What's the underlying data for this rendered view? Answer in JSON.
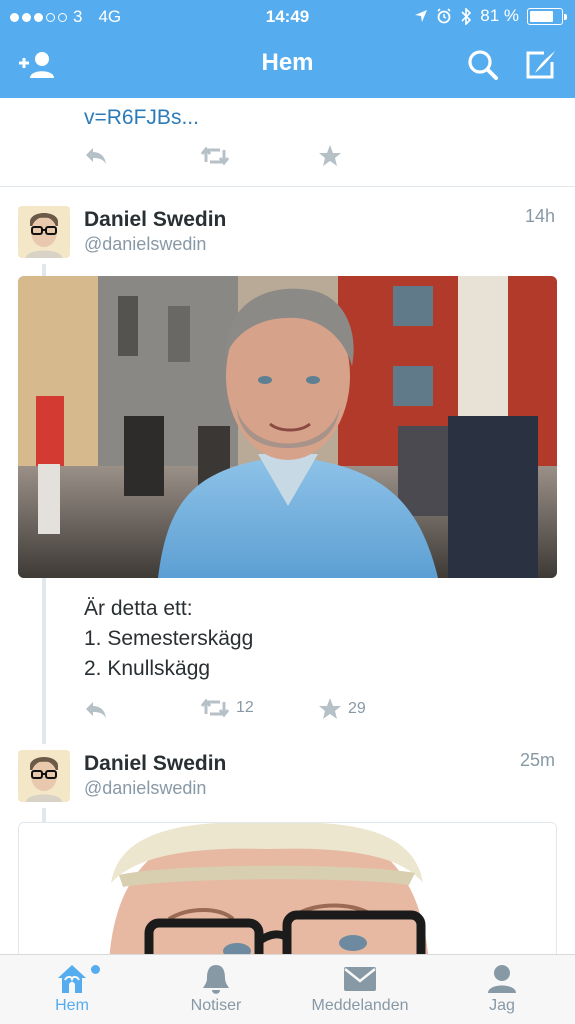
{
  "status_bar": {
    "carrier": "3",
    "network": "4G",
    "time": "14:49",
    "battery": "81 %",
    "battery_level": 0.81
  },
  "nav": {
    "title": "Hem",
    "add_user_icon": "add-user-icon",
    "search_icon": "search-icon",
    "compose_icon": "compose-icon"
  },
  "prev_tweet": {
    "link_text": "v=R6FJBs..."
  },
  "tweets": [
    {
      "name": "Daniel Swedin",
      "handle": "@danielswedin",
      "time": "14h",
      "text_lines": [
        "Är detta ett:",
        "1. Semesterskägg",
        "2. Knullskägg"
      ],
      "retweets": "12",
      "favorites": "29"
    },
    {
      "name": "Daniel Swedin",
      "handle": "@danielswedin",
      "time": "25m"
    }
  ],
  "tabs": [
    {
      "label": "Hem",
      "icon": "home-icon"
    },
    {
      "label": "Notiser",
      "icon": "bell-icon"
    },
    {
      "label": "Meddelanden",
      "icon": "envelope-icon"
    },
    {
      "label": "Jag",
      "icon": "person-icon"
    }
  ],
  "colors": {
    "brand": "#55acee",
    "link": "#2b7bb9",
    "muted": "#8899a6",
    "action": "#b5c0c7"
  }
}
